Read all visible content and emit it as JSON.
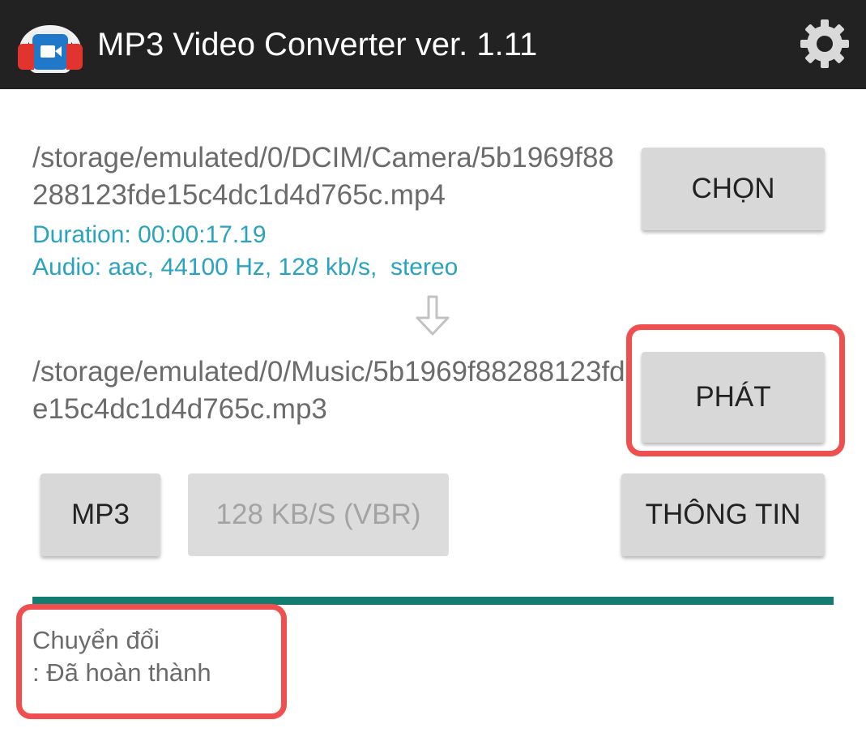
{
  "header": {
    "title": "MP3 Video Converter ver. 1.11",
    "app_icon": "headphones-video-icon",
    "settings_icon": "gear-icon"
  },
  "input": {
    "path": "/storage/emulated/0/DCIM/Camera/5b1969f88288123fde15c4dc1d4d765c.mp4",
    "duration": "Duration: 00:00:17.19",
    "audio": "Audio: aac, 44100 Hz, 128 kb/s,  stereo",
    "select_label": "CHỌN"
  },
  "output": {
    "path": "/storage/emulated/0/Music/5b1969f88288123fde15c4dc1d4d765c.mp3",
    "play_label": "PHÁT"
  },
  "options": {
    "format_label": "MP3",
    "bitrate_label": "128 KB/S (VBR)",
    "info_label": "THÔNG TIN"
  },
  "progress": {
    "fraction": 1.0
  },
  "status": {
    "line1": "Chuyển đổi",
    "line2": ": Đã hoàn thành"
  },
  "colors": {
    "topbar": "#222222",
    "accent_info": "#2aa3c0",
    "progress": "#137c70",
    "highlight": "#ef4f4f"
  }
}
